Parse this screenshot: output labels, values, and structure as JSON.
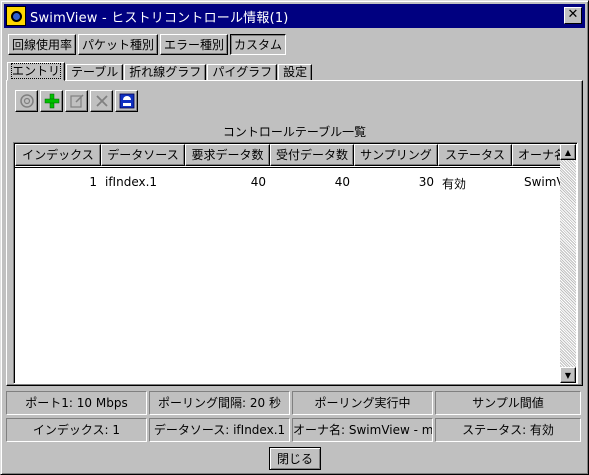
{
  "window": {
    "title": "SwimView - ヒストリコントロール情報(1)",
    "close_glyph": "✕"
  },
  "toggle_buttons": [
    {
      "label": "回線使用率",
      "pressed": false
    },
    {
      "label": "パケット種別",
      "pressed": false
    },
    {
      "label": "エラー種別",
      "pressed": false
    },
    {
      "label": "カスタム",
      "pressed": true
    }
  ],
  "tabs": [
    {
      "label": "エントリ",
      "active": true
    },
    {
      "label": "テーブル",
      "active": false
    },
    {
      "label": "折れ線グラフ",
      "active": false
    },
    {
      "label": "パイグラフ",
      "active": false
    },
    {
      "label": "設定",
      "active": false
    }
  ],
  "toolbar": {
    "icons": [
      "refresh-icon",
      "add-icon",
      "edit-icon",
      "delete-icon",
      "save-icon"
    ]
  },
  "table": {
    "caption": "コントロールテーブル一覧",
    "columns": [
      "インデックス",
      "データソース",
      "要求データ数",
      "受付データ数",
      "サンプリング",
      "ステータス",
      "オーナ名"
    ],
    "rows": [
      [
        "1",
        "ifIndex.1",
        "40",
        "40",
        "30",
        "有効",
        "SwimView - morio"
      ]
    ]
  },
  "status_bar": {
    "row1": [
      "ポート1: 10 Mbps",
      "ポーリング間隔: 20 秒",
      "ポーリング実行中",
      "サンプル間値"
    ],
    "row2": [
      "インデックス: 1",
      "データソース: ifIndex.1",
      "オーナ名: SwimView - morio",
      "ステータス: 有効"
    ]
  },
  "footer": {
    "close_label": "閉じる"
  },
  "colors": {
    "titlebar": "#000080",
    "face": "#c0c0c0",
    "add_icon": "#00c000",
    "save_icon": "#1030c0"
  }
}
